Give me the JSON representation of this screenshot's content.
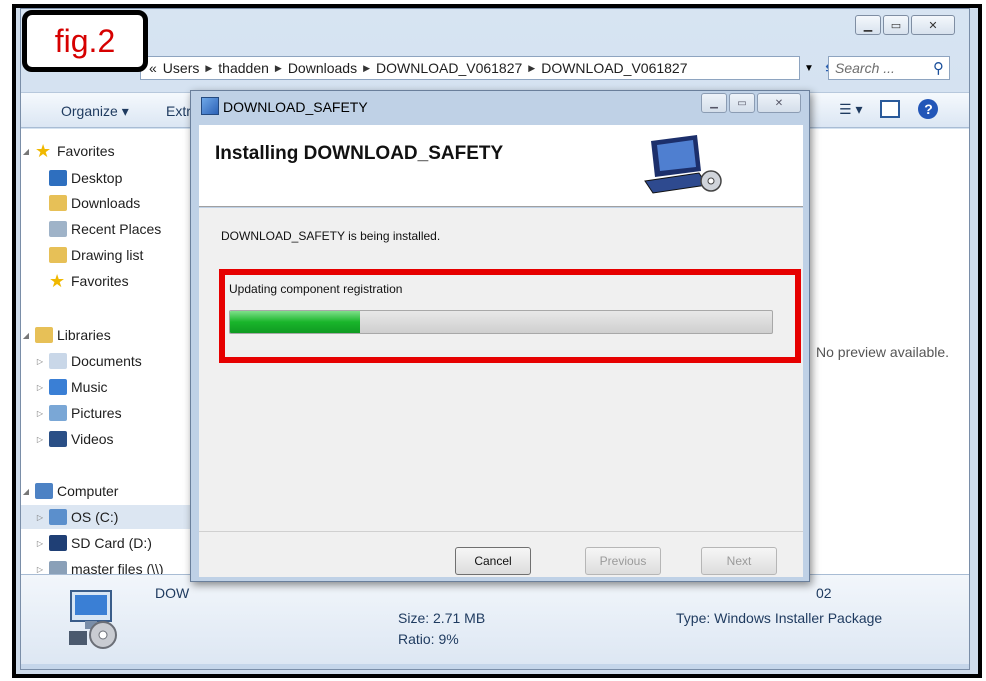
{
  "figure_label": "fig.2",
  "explorer": {
    "breadcrumb": [
      "«",
      "Users",
      "thadden",
      "Downloads",
      "DOWNLOAD_V061827",
      "DOWNLOAD_V061827"
    ],
    "search_placeholder": "Search ...",
    "toolbar": {
      "organize": "Organize ▾",
      "extract": "Extr"
    },
    "nav": {
      "favorites": "Favorites",
      "desktop": "Desktop",
      "downloads": "Downloads",
      "recent_places": "Recent Places",
      "drawing_list": "Drawing list",
      "favorites2": "Favorites",
      "libraries": "Libraries",
      "documents": "Documents",
      "music": "Music",
      "pictures": "Pictures",
      "videos": "Videos",
      "computer": "Computer",
      "os_c": "OS (C:)",
      "sd_card": "SD Card (D:)",
      "master_files": "master files (\\\\)"
    },
    "preview_text": "No preview available.",
    "details": {
      "name": "DOW",
      "size": "Size: 2.71 MB",
      "ratio": "Ratio: 9%",
      "type": "Type: Windows Installer Package",
      "date_fragment": "02"
    }
  },
  "dialog": {
    "title": "DOWNLOAD_SAFETY",
    "heading": "Installing DOWNLOAD_SAFETY",
    "status": "DOWNLOAD_SAFETY is being installed.",
    "progress_label": "Updating component registration",
    "progress_fraction": 0.24,
    "buttons": {
      "cancel": "Cancel",
      "previous": "Previous",
      "next": "Next"
    }
  },
  "colors": {
    "highlight": "#e60000",
    "progress": "#19b52b",
    "figure_label": "#d60000"
  }
}
